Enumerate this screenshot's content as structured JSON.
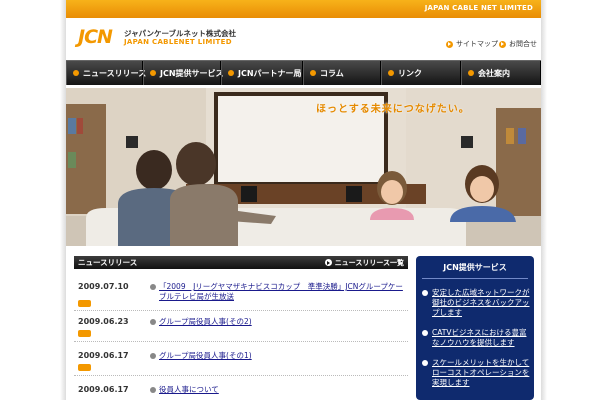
{
  "topbar": {
    "text": "JAPAN CABLE NET LIMITED"
  },
  "header": {
    "logo_mark": "JCN",
    "logo_jp": "ジャパンケーブルネット株式会社",
    "logo_en": "JAPAN CABLENET LIMITED",
    "sitemap": "サイトマップ",
    "contact": "お問合せ"
  },
  "nav": {
    "items": [
      {
        "label": "ニュースリリース"
      },
      {
        "label": "JCN提供サービス"
      },
      {
        "label": "JCNパートナー局"
      },
      {
        "label": "コラム"
      },
      {
        "label": "リンク"
      },
      {
        "label": "会社案内"
      }
    ]
  },
  "hero": {
    "caption": "ほっとする未来につなげたい。"
  },
  "news": {
    "title": "ニュースリリース",
    "more": "ニュースリリース一覧",
    "items": [
      {
        "date": "2009.07.10",
        "text": "「2009　Jリーグヤマザキナビスコカップ　準準決勝」JCNグループケーブルテレビ局が生放送"
      },
      {
        "date": "2009.06.23",
        "text": "グループ局役員人事(その2)"
      },
      {
        "date": "2009.06.17",
        "text": "グループ局役員人事(その1)"
      },
      {
        "date": "2009.06.17",
        "text": "役員人事について"
      }
    ]
  },
  "services": {
    "title": "JCN提供サービス",
    "items": [
      {
        "text": "安定した広域ネットワークが御社のビジネスをバックアップします"
      },
      {
        "text": "CATVビジネスにおける豊富なノウハウを提供します"
      },
      {
        "text": "スケールメリットを生かしてローコストオペレーションを実現します"
      }
    ]
  },
  "colors": {
    "accent": "#f39800",
    "nav_bg": "#141414",
    "service_bg": "#0f2a6e",
    "link": "#1a1a8c"
  }
}
